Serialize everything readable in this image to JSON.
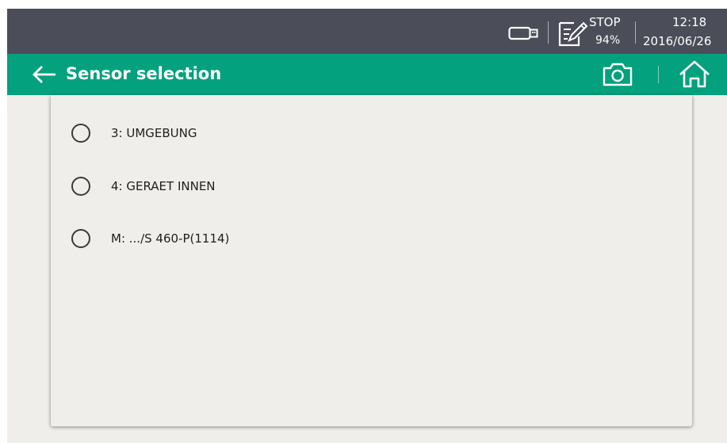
{
  "status_bar": {
    "state": "STOP",
    "battery": "94%",
    "time": "12:18",
    "date": "2016/06/26",
    "icons": [
      "usb-stick-icon",
      "memo-pen-icon"
    ]
  },
  "title_bar": {
    "title": "Sensor selection",
    "icons": [
      "back-arrow-icon",
      "camera-icon",
      "home-icon"
    ]
  },
  "sensors": [
    {
      "label": "3: UMGEBUNG",
      "selected": false
    },
    {
      "label": "4: GERAET INNEN",
      "selected": false
    },
    {
      "label": "M: .../S 460-P(1114)",
      "selected": false
    }
  ],
  "colors": {
    "status_bar": "#4b4d58",
    "title_bar": "#04a17e",
    "background": "#efeeea"
  }
}
